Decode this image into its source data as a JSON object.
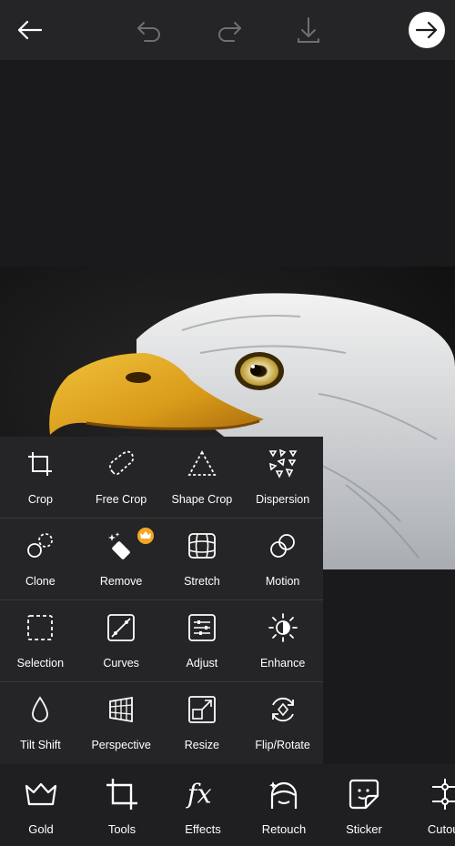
{
  "header": {
    "back_icon": "arrow-left-icon",
    "undo_icon": "undo-icon",
    "redo_icon": "redo-icon",
    "download_icon": "download-icon",
    "next_icon": "arrow-right-icon"
  },
  "tools": {
    "rows": [
      [
        {
          "label": "Crop",
          "icon": "crop-icon"
        },
        {
          "label": "Free Crop",
          "icon": "free-crop-icon"
        },
        {
          "label": "Shape Crop",
          "icon": "shape-crop-icon"
        },
        {
          "label": "Dispersion",
          "icon": "dispersion-icon"
        }
      ],
      [
        {
          "label": "Clone",
          "icon": "clone-icon"
        },
        {
          "label": "Remove",
          "icon": "remove-icon",
          "premium": true
        },
        {
          "label": "Stretch",
          "icon": "stretch-icon"
        },
        {
          "label": "Motion",
          "icon": "motion-icon"
        }
      ],
      [
        {
          "label": "Selection",
          "icon": "selection-icon"
        },
        {
          "label": "Curves",
          "icon": "curves-icon"
        },
        {
          "label": "Adjust",
          "icon": "adjust-icon"
        },
        {
          "label": "Enhance",
          "icon": "enhance-icon"
        }
      ],
      [
        {
          "label": "Tilt Shift",
          "icon": "tilt-shift-icon"
        },
        {
          "label": "Perspective",
          "icon": "perspective-icon"
        },
        {
          "label": "Resize",
          "icon": "resize-icon"
        },
        {
          "label": "Flip/Rotate",
          "icon": "flip-rotate-icon"
        }
      ]
    ]
  },
  "bottom_nav": [
    {
      "label": "Gold",
      "icon": "crown-icon"
    },
    {
      "label": "Tools",
      "icon": "crop-icon"
    },
    {
      "label": "Effects",
      "icon": "fx-icon"
    },
    {
      "label": "Retouch",
      "icon": "face-icon"
    },
    {
      "label": "Sticker",
      "icon": "sticker-icon"
    },
    {
      "label": "Cutout",
      "icon": "cutout-icon"
    }
  ],
  "colors": {
    "background": "#1a1a1c",
    "panel": "#252527",
    "premium_badge": "#f5a623"
  }
}
